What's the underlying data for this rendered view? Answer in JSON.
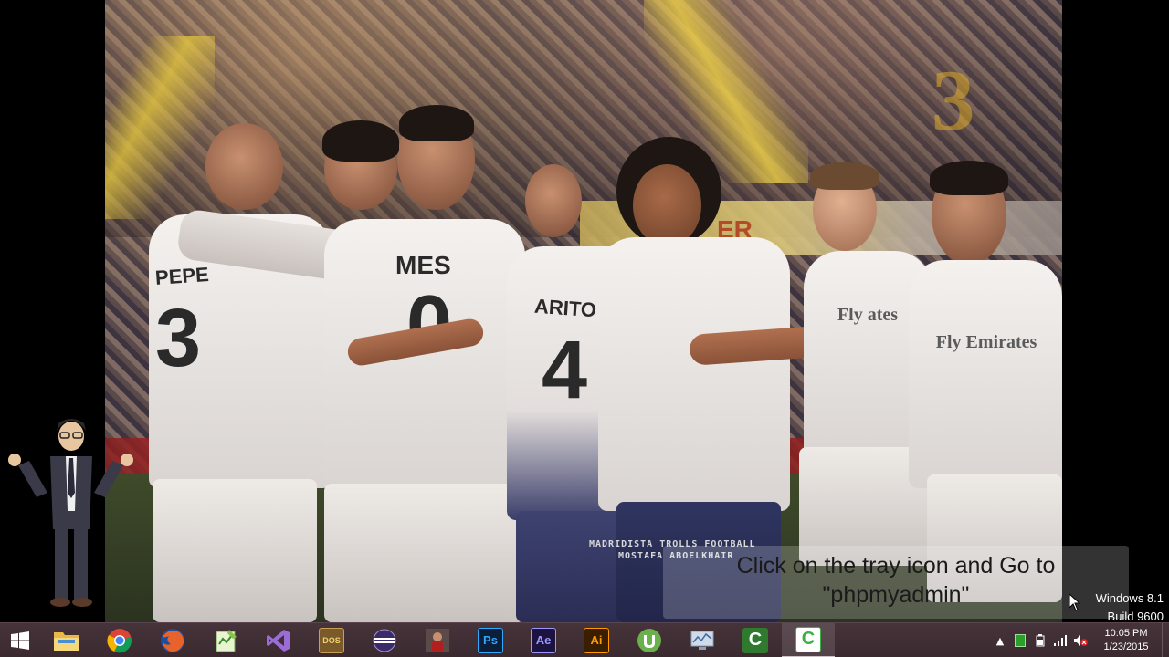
{
  "caption": {
    "line1": "Click on the tray icon and Go to",
    "line2": "\"phpmyadmin\""
  },
  "windows_watermark": {
    "line1": "Windows 8.1",
    "line2": "Build 9600"
  },
  "wallpaper": {
    "watermark_line1": "MADRIDISTA TROLLS FOOTBALL",
    "watermark_line2": "MOSTAFA ABOELKHAIR",
    "jersey_names": [
      "PEPE",
      "MES",
      "ARITO"
    ],
    "jersey_numbers": [
      "3",
      "0",
      "4"
    ],
    "sponsor": "Fly Emirates",
    "sponsor_partial": "Fly ates",
    "banner_text": "ER",
    "gold_number": "3"
  },
  "taskbar": {
    "start_icon": "windows-logo-icon",
    "pinned": [
      {
        "name": "file-explorer",
        "icon": "folder-icon",
        "label": ""
      },
      {
        "name": "chrome",
        "icon": "chrome-icon",
        "label": ""
      },
      {
        "name": "firefox",
        "icon": "firefox-icon",
        "label": ""
      },
      {
        "name": "notepad-plus",
        "icon": "notepad-icon",
        "label": ""
      },
      {
        "name": "visual-studio",
        "icon": "visual-studio-icon",
        "label": ""
      },
      {
        "name": "dosbox",
        "icon": "dosbox-icon",
        "label": "DOS"
      },
      {
        "name": "eclipse",
        "icon": "eclipse-icon",
        "label": ""
      },
      {
        "name": "game",
        "icon": "game-icon",
        "label": ""
      },
      {
        "name": "photoshop",
        "icon": "photoshop-icon",
        "label": "Ps"
      },
      {
        "name": "after-effects",
        "icon": "after-effects-icon",
        "label": "Ae"
      },
      {
        "name": "illustrator",
        "icon": "illustrator-icon",
        "label": "Ai"
      },
      {
        "name": "utorrent",
        "icon": "utorrent-icon",
        "label": ""
      },
      {
        "name": "task-manager",
        "icon": "monitor-icon",
        "label": ""
      },
      {
        "name": "camtasia-1",
        "icon": "camtasia-icon",
        "label": "C"
      },
      {
        "name": "camtasia-2",
        "icon": "camtasia-icon",
        "label": "C"
      }
    ],
    "active_index": 14
  },
  "tray": {
    "icons": [
      "show-hidden-icon",
      "server-icon",
      "power-icon",
      "signal-icon",
      "volume-muted-icon"
    ],
    "time": "10:05 PM",
    "date": "1/23/2015"
  },
  "colors": {
    "taskbar_bg": "#3a2a30",
    "chrome_red": "#db4437",
    "ps_blue": "#31a8ff",
    "ae_purple": "#9999ff",
    "ai_orange": "#ff9a00",
    "camtasia_green": "#3cb043"
  }
}
